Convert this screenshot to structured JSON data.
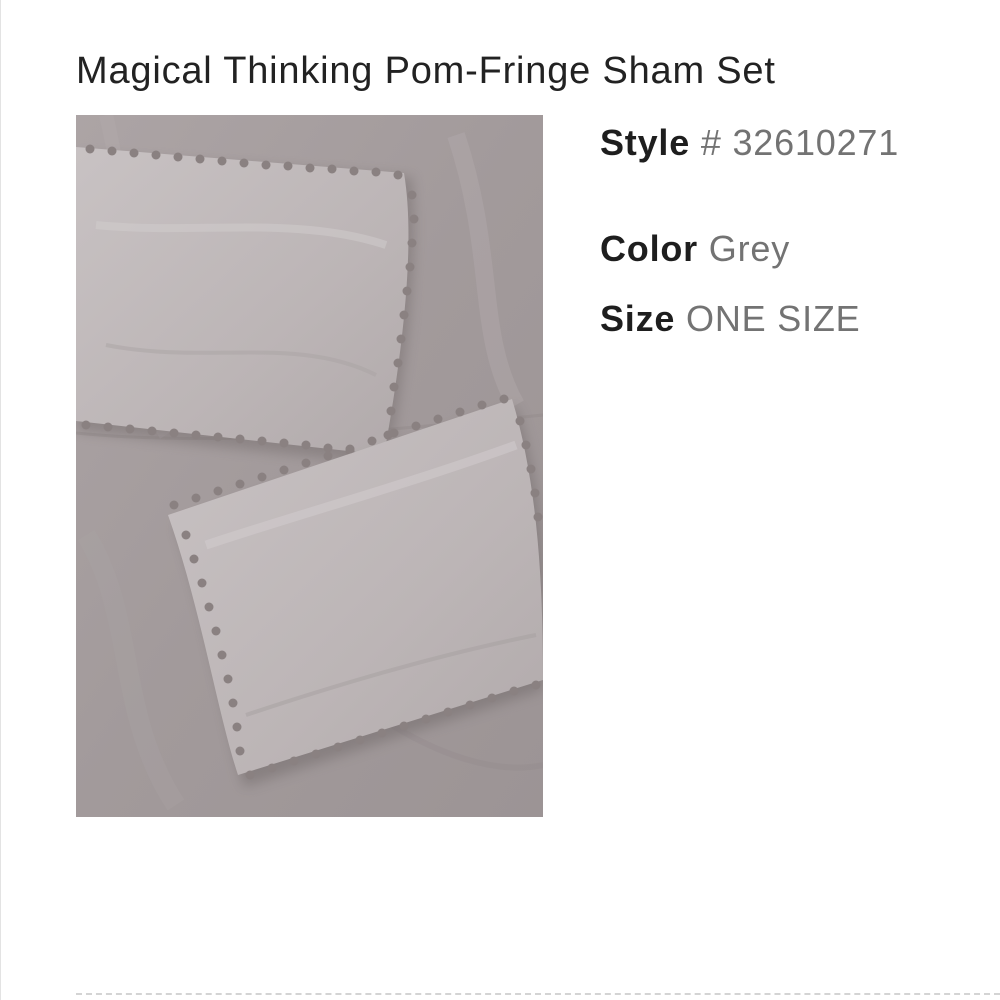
{
  "product": {
    "title": "Magical Thinking Pom-Fringe Sham Set",
    "image": {
      "kind": "product-photo",
      "colors": {
        "background": "#a39c9c",
        "pillow": "#c1bbbc",
        "pompom": "#8a8181"
      }
    },
    "style": {
      "label": "Style",
      "value": "# 32610271"
    },
    "color": {
      "label": "Color",
      "value": "Grey"
    },
    "size": {
      "label": "Size",
      "value": "ONE SIZE"
    }
  }
}
